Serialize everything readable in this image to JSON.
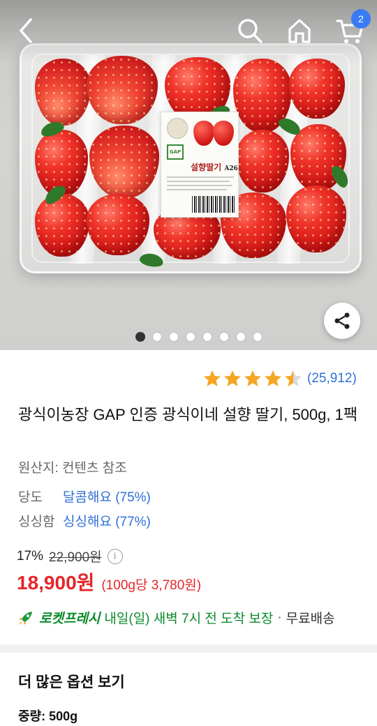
{
  "top_bar": {
    "back_icon": "chevron-left-icon",
    "search_icon": "search-icon",
    "home_icon": "home-icon",
    "cart_icon": "cart-icon",
    "cart_count": "2"
  },
  "hero": {
    "label_title": "설향딸기",
    "label_code": "A26",
    "label_badge": "GAP",
    "carousel_total": 8,
    "carousel_active": 1,
    "share_icon": "share-icon"
  },
  "product": {
    "rating": 4.5,
    "review_count": "(25,912)",
    "title": "광식이농장 GAP 인증 광식이네 설향 딸기, 500g, 1팩",
    "origin": "원산지: 컨텐츠 참조",
    "attributes": [
      {
        "label": "당도",
        "value": "달콤해요 (75%)"
      },
      {
        "label": "싱싱함",
        "value": "싱싱해요 (77%)"
      }
    ],
    "discount_rate": "17%",
    "original_price": "22,900원",
    "sale_price": "18,900원",
    "unit_price": "(100g당 3,780원)",
    "delivery": {
      "brand": "로켓프레시",
      "text": "내일(일) 새벽 7시 전 도착 보장",
      "separator": "·",
      "shipping": "무료배송"
    }
  },
  "options": {
    "title": "더 많은 옵션 보기",
    "weight_label": "중량:",
    "weight_value": "500g"
  },
  "colors": {
    "accent_blue": "#2f6fd8",
    "price_red": "#e52528",
    "rocket_green": "#0a8a2a",
    "star_gold": "#f5a623"
  }
}
